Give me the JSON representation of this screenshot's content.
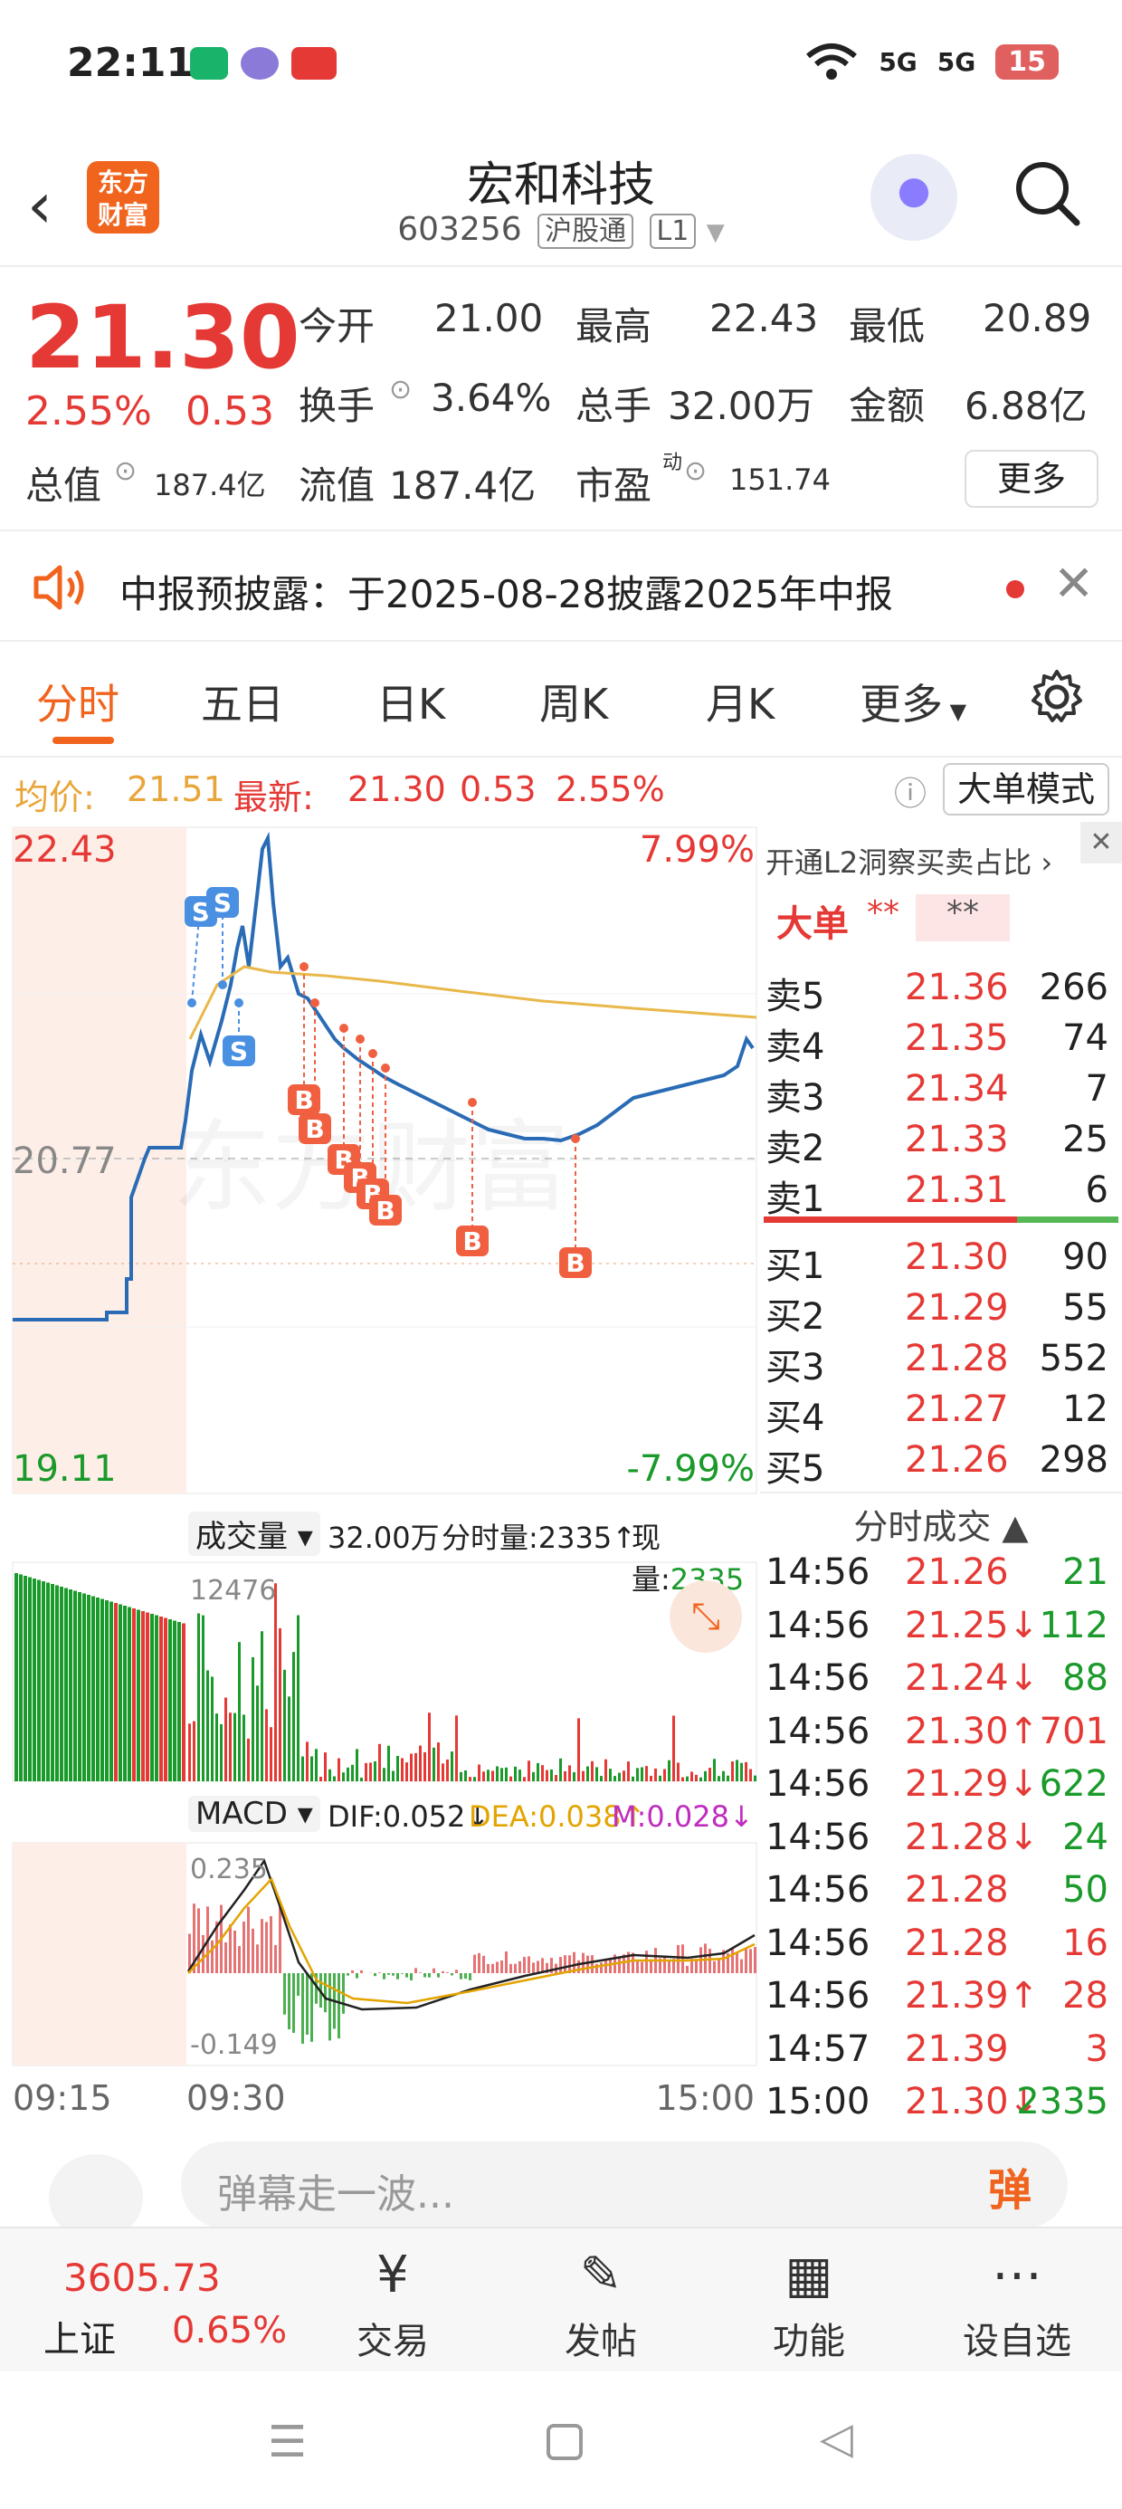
{
  "statusbar": {
    "time": "22:11",
    "battery": "15",
    "net1": "5G",
    "net2": "5G"
  },
  "header": {
    "logo_line1": "东方",
    "logo_line2": "财富",
    "title": "宏和科技",
    "code": "603256",
    "tag1": "沪股通",
    "tag2": "L1"
  },
  "quote": {
    "price": "21.30",
    "change_pct": "2.55%",
    "change": "0.53",
    "open_label": "今开",
    "open": "21.00",
    "high_label": "最高",
    "high": "22.43",
    "low_label": "最低",
    "low": "20.89",
    "turnover_label": "换手",
    "turnover": "3.64%",
    "volume_label": "总手",
    "volume": "32.00万",
    "amount_label": "金额",
    "amount": "6.88亿",
    "mktcap_label": "总值",
    "mktcap": "187.4亿",
    "float_label": "流值",
    "float": "187.4亿",
    "pe_label": "市盈",
    "pe_sup": "动",
    "pe": "151.74",
    "more": "更多"
  },
  "notice": {
    "text": "中报预披露：于2025-08-28披露2025年中报"
  },
  "tabs": [
    "分时",
    "五日",
    "日K",
    "周K",
    "月K",
    "更多"
  ],
  "avgline": {
    "avg_label": "均价:",
    "avg": "21.51",
    "last_label": "最新:",
    "last": "21.30",
    "chg": "0.53",
    "pct": "2.55%",
    "bigorder": "大单模式"
  },
  "chart_labels": {
    "ymax": "22.43",
    "ymin": "19.11",
    "pre": "20.77",
    "pmax": "7.99%",
    "pmin": "-7.99%",
    "vol_selector": "成交量",
    "vol_total": "32.00万",
    "vol_min": "分时量:2335↑",
    "vol_now_label": "现量:",
    "vol_now": "2335",
    "vol_max": "12476",
    "macd_selector": "MACD",
    "dif": "DIF:0.052↓",
    "dea": "DEA:0.038↑",
    "m": "M:0.028↓",
    "macd_max": "0.235",
    "macd_min": "-0.149",
    "t0": "09:15",
    "t1": "09:30",
    "t2": "15:00",
    "watermark": "东方财富"
  },
  "side": {
    "l2_text": "开通L2洞察买卖占比",
    "big_label": "大单",
    "big_v1": "**",
    "big_v2": "**",
    "asks": [
      {
        "label": "卖5",
        "price": "21.36",
        "vol": "266"
      },
      {
        "label": "卖4",
        "price": "21.35",
        "vol": "74"
      },
      {
        "label": "卖3",
        "price": "21.34",
        "vol": "7"
      },
      {
        "label": "卖2",
        "price": "21.33",
        "vol": "25"
      },
      {
        "label": "卖1",
        "price": "21.31",
        "vol": "6"
      }
    ],
    "bids": [
      {
        "label": "买1",
        "price": "21.30",
        "vol": "90"
      },
      {
        "label": "买2",
        "price": "21.29",
        "vol": "55"
      },
      {
        "label": "买3",
        "price": "21.28",
        "vol": "552"
      },
      {
        "label": "买4",
        "price": "21.27",
        "vol": "12"
      },
      {
        "label": "买5",
        "price": "21.26",
        "vol": "298"
      }
    ],
    "ticks_title": "分时成交",
    "ticks": [
      {
        "t": "14:56",
        "p": "21.26",
        "v": "21",
        "dir": "buy"
      },
      {
        "t": "14:56",
        "p": "21.25↓",
        "v": "112",
        "dir": "buy"
      },
      {
        "t": "14:56",
        "p": "21.24↓",
        "v": "88",
        "dir": "buy"
      },
      {
        "t": "14:56",
        "p": "21.30↑",
        "v": "701",
        "dir": "sell"
      },
      {
        "t": "14:56",
        "p": "21.29↓",
        "v": "622",
        "dir": "buy"
      },
      {
        "t": "14:56",
        "p": "21.28↓",
        "v": "24",
        "dir": "buy"
      },
      {
        "t": "14:56",
        "p": "21.28",
        "v": "50",
        "dir": "buy"
      },
      {
        "t": "14:56",
        "p": "21.28",
        "v": "16",
        "dir": "sell"
      },
      {
        "t": "14:56",
        "p": "21.39↑",
        "v": "28",
        "dir": "sell"
      },
      {
        "t": "14:57",
        "p": "21.39",
        "v": "3",
        "dir": "sell"
      },
      {
        "t": "15:00",
        "p": "21.30↓",
        "v": "2335",
        "dir": "buy"
      }
    ]
  },
  "danmu": {
    "placeholder": "弹幕走一波...",
    "btn": "弹"
  },
  "bottombar": {
    "index_value": "3605.73",
    "index_name": "上证",
    "index_pct": "0.65%",
    "items": [
      "交易",
      "发帖",
      "功能",
      "设自选"
    ]
  },
  "colors": {
    "up": "#e53935",
    "down": "#1a9a2a",
    "accent": "#f0641e",
    "price_line": "#2a6bb5",
    "avg_line": "#e8b84a"
  }
}
